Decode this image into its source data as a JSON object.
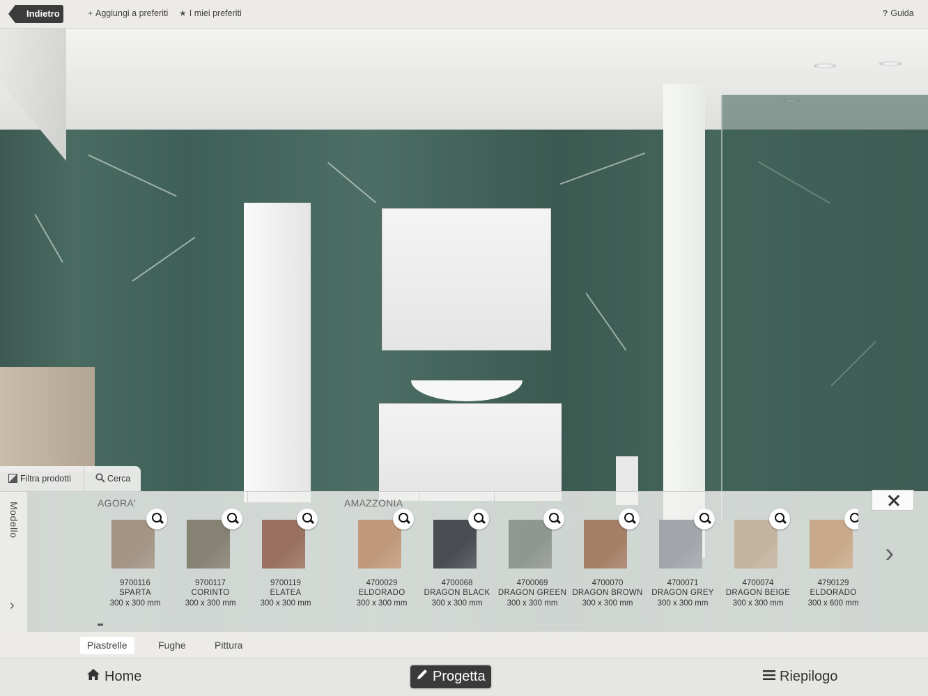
{
  "topbar": {
    "back_label": "Indietro",
    "add_favorites_label": "Aggiungi a preferiti",
    "my_favorites_label": "I miei preferiti",
    "help_label": "Guida"
  },
  "filters": {
    "filter_label": "Filtra prodotti",
    "search_label": "Cerca"
  },
  "catalog": {
    "side_tab_label": "Modello",
    "groups": [
      {
        "label": "AGORA'"
      },
      {
        "label": "AMAZZONIA"
      }
    ],
    "products": [
      {
        "code": "9700116",
        "name": "SPARTA",
        "size": "300 x 300 mm",
        "color": "#a39484"
      },
      {
        "code": "9700117",
        "name": "CORINTO",
        "size": "300 x 300 mm",
        "color": "#858273"
      },
      {
        "code": "9700119",
        "name": "ELATEA",
        "size": "300 x 300 mm",
        "color": "#9a7160"
      },
      {
        "code": "4700029",
        "name": "ELDORADO",
        "size": "300 x 300 mm",
        "color": "#c19a7c"
      },
      {
        "code": "4700068",
        "name": "DRAGON BLACK",
        "size": "300 x 300 mm",
        "color": "#4a4d52"
      },
      {
        "code": "4700069",
        "name": "DRAGON GREEN",
        "size": "300 x 300 mm",
        "color": "#909690"
      },
      {
        "code": "4700070",
        "name": "DRAGON BROWN",
        "size": "300 x 300 mm",
        "color": "#a47e66"
      },
      {
        "code": "4700071",
        "name": "DRAGON GREY",
        "size": "300 x 300 mm",
        "color": "#a2a6aa"
      },
      {
        "code": "4700074",
        "name": "DRAGON BEIGE",
        "size": "300 x 300 mm",
        "color": "#c4b39e"
      },
      {
        "code": "4790129",
        "name": "ELDORADO",
        "size": "300 x 600 mm",
        "color": "#c8aa8a"
      }
    ]
  },
  "subtabs": [
    "Piastrelle",
    "Fughe",
    "Pittura"
  ],
  "nav": {
    "home_label": "Home",
    "design_label": "Progetta",
    "summary_label": "Riepilogo"
  }
}
